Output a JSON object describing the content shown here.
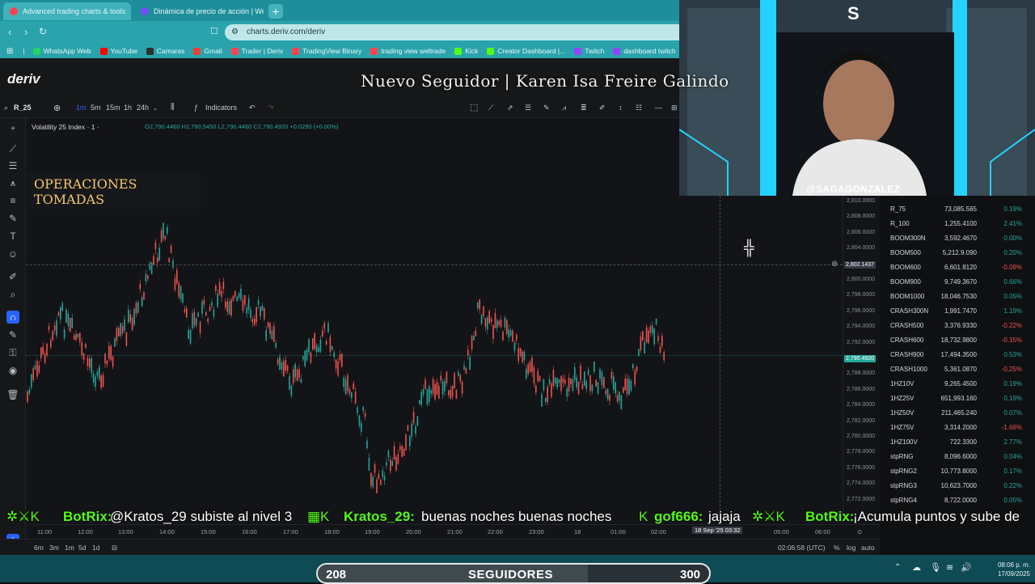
{
  "browser": {
    "tabs": [
      {
        "label": "Advanced trading charts & tools",
        "color": "#ff444f"
      },
      {
        "label": "Dinámica de precio de acción | We...",
        "color": "#7b4bff"
      }
    ],
    "url": "charts.deriv.com/deriv",
    "bookmarks": [
      {
        "label": "WhatsApp Web",
        "color": "#25d366"
      },
      {
        "label": "YouTube",
        "color": "#ff0000"
      },
      {
        "label": "Camaras",
        "color": "#2f2f2f"
      },
      {
        "label": "Gmail",
        "color": "#ea4335"
      },
      {
        "label": "Trader | Deriv",
        "color": "#ff444f"
      },
      {
        "label": "TradingView Binary",
        "color": "#ff444f"
      },
      {
        "label": "trading view weltrade",
        "color": "#ff444f"
      },
      {
        "label": "Kick",
        "color": "#53fc18"
      },
      {
        "label": "Creator Dashboard |...",
        "color": "#53fc18"
      },
      {
        "label": "Twitch",
        "color": "#9146ff"
      },
      {
        "label": "dashboard twitch",
        "color": "#9146ff"
      }
    ]
  },
  "deriv": {
    "logo": "deriv",
    "symbol_search": "R_25",
    "timeframes": [
      "1m",
      "5m",
      "15m",
      "1h",
      "24h"
    ],
    "indicators_label": "Indicators",
    "instrument": "Volatility 25 Index · 1 ·",
    "ohlc": "O2,790.4460 H2,790.5450 L2,790.4460 C2,790.4920 +0.0290 (+0.00%)",
    "price_ticks": [
      "2,810.0000",
      "2,808.0000",
      "2,806.0000",
      "2,804.0000",
      "2,802.1437",
      "2,800.0000",
      "2,798.0000",
      "2,796.0000",
      "2,794.0000",
      "2,792.0000",
      "2,790.4920",
      "2,788.0000",
      "2,786.0000",
      "2,784.0000",
      "2,782.0000",
      "2,780.0000",
      "2,778.0000",
      "2,776.0000",
      "2,774.0000",
      "2,772.0000"
    ],
    "crosshair_price": "2,802.1437",
    "current_price": "2,790.4920",
    "time_ticks": [
      "11:00",
      "12:00",
      "13:00",
      "14:00",
      "15:00",
      "16:00",
      "17:00",
      "18:00",
      "19:00",
      "20:00",
      "21:00",
      "22:00",
      "23:00",
      "18",
      "01:00",
      "02:00",
      "05:00",
      "06:00"
    ],
    "crosshair_time": "18 Sep '25   03:32",
    "ranges": [
      "6m",
      "3m",
      "1m",
      "5d",
      "1d"
    ],
    "utc_clock": "02:06:58 (UTC)",
    "scale_opts": [
      "%",
      "log",
      "auto"
    ]
  },
  "watchlist": [
    {
      "sym": "R_75",
      "px": "73,085.565",
      "ch": "0.19%",
      "up": true
    },
    {
      "sym": "R_100",
      "px": "1,255.4100",
      "ch": "2.41%",
      "up": true
    },
    {
      "sym": "BOOM300N",
      "px": "3,592.4670",
      "ch": "0.00%",
      "up": true
    },
    {
      "sym": "BOOM500",
      "px": "5,212.9.090",
      "ch": "0.20%",
      "up": true
    },
    {
      "sym": "BOOM600",
      "px": "6,601.8120",
      "ch": "-0.09%",
      "up": false
    },
    {
      "sym": "BOOM900",
      "px": "9,749.3670",
      "ch": "0.66%",
      "up": true
    },
    {
      "sym": "BOOM1000",
      "px": "18,046.7530",
      "ch": "0.05%",
      "up": true
    },
    {
      "sym": "CRASH300N",
      "px": "1,991.7470",
      "ch": "1.19%",
      "up": true
    },
    {
      "sym": "CRASH500",
      "px": "3,376.9330",
      "ch": "-0.22%",
      "up": false
    },
    {
      "sym": "CRASH600",
      "px": "18,732.9800",
      "ch": "-0.15%",
      "up": false
    },
    {
      "sym": "CRASH900",
      "px": "17,494.3500",
      "ch": "0.53%",
      "up": true
    },
    {
      "sym": "CRASH1000",
      "px": "5,361.0870",
      "ch": "-0.25%",
      "up": false
    },
    {
      "sym": "1HZ10V",
      "px": "9,265.4500",
      "ch": "0.19%",
      "up": true
    },
    {
      "sym": "1HZ25V",
      "px": "651,993.160",
      "ch": "0.19%",
      "up": true
    },
    {
      "sym": "1HZ50V",
      "px": "211,465.240",
      "ch": "0.07%",
      "up": true
    },
    {
      "sym": "1HZ75V",
      "px": "3,314.2000",
      "ch": "-1.66%",
      "up": false
    },
    {
      "sym": "1HZ100V",
      "px": "722.3300",
      "ch": "2.77%",
      "up": true
    },
    {
      "sym": "stpRNG",
      "px": "8,096.6000",
      "ch": "0.04%",
      "up": true
    },
    {
      "sym": "stpRNG2",
      "px": "10,773.8000",
      "ch": "0.17%",
      "up": true
    },
    {
      "sym": "stpRNG3",
      "px": "10,623.7000",
      "ch": "0.22%",
      "up": true
    },
    {
      "sym": "stpRNG4",
      "px": "8,722.0000",
      "ch": "0.05%",
      "up": true
    }
  ],
  "stream": {
    "webcam_handle": "@SAGAGONZALEZ",
    "new_follower": "Nuevo Seguidor | Karen Isa Freire Galindo",
    "ops_title": "OPERACIONES TOMADAS",
    "chat": [
      {
        "user": "BotRix:",
        "msg": "@Kratos_29 subiste al nivel 3"
      },
      {
        "user": "Kratos_29:",
        "msg": "buenas noches buenas noches"
      },
      {
        "user": "gof666:",
        "msg": "jajaja"
      },
      {
        "user": "BotRix:",
        "msg": "¡Acumula puntos y sube de"
      }
    ],
    "follower_count": "208",
    "follower_label": "SEGUIDORES",
    "follower_goal": "300",
    "follower_progress": 0.69
  },
  "system": {
    "time": "08:06 p. m.",
    "date": "17/09/2025"
  },
  "colors": {
    "up": "#26a69a",
    "down": "#ef5350",
    "accent": "#ff444f"
  }
}
